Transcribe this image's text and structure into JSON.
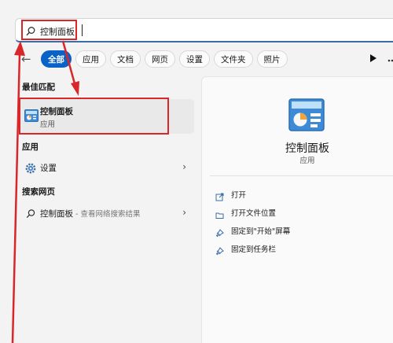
{
  "search": {
    "query": "控制面板"
  },
  "filters": [
    "全部",
    "应用",
    "文档",
    "网页",
    "设置",
    "文件夹",
    "照片"
  ],
  "sections": {
    "best_match": "最佳匹配",
    "apps": "应用",
    "web": "搜索网页"
  },
  "best_match": {
    "name": "控制面板",
    "type": "应用"
  },
  "apps": [
    {
      "label": "设置"
    }
  ],
  "web": {
    "query": "控制面板",
    "hint": " - 查看网络搜索结果"
  },
  "detail": {
    "title": "控制面板",
    "subtitle": "应用",
    "actions": [
      "打开",
      "打开文件位置",
      "固定到\"开始\"屏幕",
      "固定到任务栏"
    ]
  },
  "colors": {
    "accent": "#0a61c6",
    "annotation": "#d9262a"
  }
}
